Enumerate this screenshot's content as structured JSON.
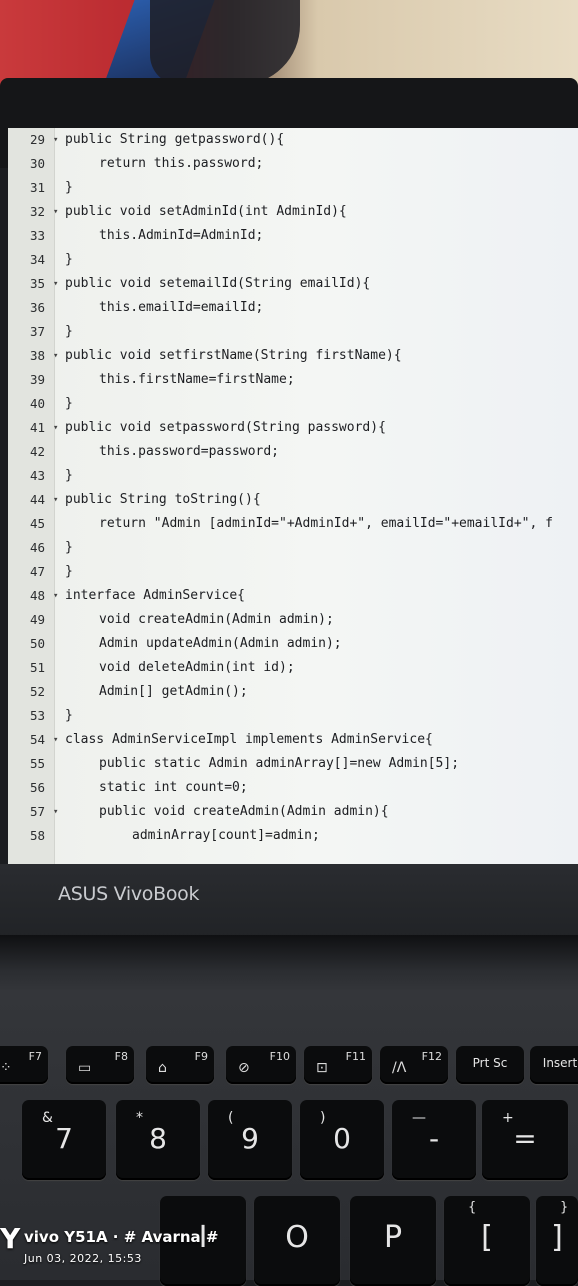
{
  "screen": {
    "lines": [
      {
        "n": "29",
        "fold": true,
        "indent": 0,
        "text": "public String getpassword(){"
      },
      {
        "n": "30",
        "fold": false,
        "indent": 1,
        "text": "return this.password;"
      },
      {
        "n": "31",
        "fold": false,
        "indent": 0,
        "text": "}"
      },
      {
        "n": "32",
        "fold": true,
        "indent": 0,
        "text": "public void setAdminId(int AdminId){"
      },
      {
        "n": "33",
        "fold": false,
        "indent": 1,
        "text": "this.AdminId=AdminId;"
      },
      {
        "n": "34",
        "fold": false,
        "indent": 0,
        "text": "}"
      },
      {
        "n": "35",
        "fold": true,
        "indent": 0,
        "text": "public void setemailId(String emailId){"
      },
      {
        "n": "36",
        "fold": false,
        "indent": 1,
        "text": "this.emailId=emailId;"
      },
      {
        "n": "37",
        "fold": false,
        "indent": 0,
        "text": "}"
      },
      {
        "n": "38",
        "fold": true,
        "indent": 0,
        "text": "public void setfirstName(String firstName){"
      },
      {
        "n": "39",
        "fold": false,
        "indent": 1,
        "text": "this.firstName=firstName;"
      },
      {
        "n": "40",
        "fold": false,
        "indent": 0,
        "text": "}"
      },
      {
        "n": "41",
        "fold": true,
        "indent": 0,
        "text": "public void setpassword(String password){"
      },
      {
        "n": "42",
        "fold": false,
        "indent": 1,
        "text": "this.password=password;"
      },
      {
        "n": "43",
        "fold": false,
        "indent": 0,
        "text": "}"
      },
      {
        "n": "44",
        "fold": true,
        "indent": 0,
        "text": "public String toString(){"
      },
      {
        "n": "45",
        "fold": false,
        "indent": 1,
        "text": "return \"Admin [adminId=\"+AdminId+\", emailId=\"+emailId+\", f"
      },
      {
        "n": "46",
        "fold": false,
        "indent": 0,
        "text": "}"
      },
      {
        "n": "47",
        "fold": false,
        "indent": 0,
        "text": "}"
      },
      {
        "n": "48",
        "fold": true,
        "indent": 0,
        "text": "interface AdminService{"
      },
      {
        "n": "49",
        "fold": false,
        "indent": 1,
        "text": "void createAdmin(Admin admin);"
      },
      {
        "n": "50",
        "fold": false,
        "indent": 1,
        "text": "Admin updateAdmin(Admin admin);"
      },
      {
        "n": "51",
        "fold": false,
        "indent": 1,
        "text": "void deleteAdmin(int id);"
      },
      {
        "n": "52",
        "fold": false,
        "indent": 1,
        "text": "Admin[] getAdmin();"
      },
      {
        "n": "53",
        "fold": false,
        "indent": 0,
        "text": "}"
      },
      {
        "n": "54",
        "fold": true,
        "indent": 0,
        "text": "class AdminServiceImpl implements AdminService{"
      },
      {
        "n": "55",
        "fold": false,
        "indent": 1,
        "text": "public static Admin adminArray[]=new Admin[5];"
      },
      {
        "n": "56",
        "fold": false,
        "indent": 1,
        "text": "static int count=0;"
      },
      {
        "n": "57",
        "fold": true,
        "indent": 1,
        "text": "public void createAdmin(Admin admin){"
      },
      {
        "n": "58",
        "fold": false,
        "indent": 2,
        "text": "adminArray[count]=admin;"
      }
    ]
  },
  "laptop": {
    "brand": "ASUS VivoBook"
  },
  "keyboard": {
    "fkeys": [
      {
        "label": "F7",
        "icon": "brightness-icon",
        "glyph": "⁘"
      },
      {
        "label": "F8",
        "icon": "display-icon",
        "glyph": "▭"
      },
      {
        "label": "F9",
        "icon": "touchpad-lock-icon",
        "glyph": "⌂"
      },
      {
        "label": "F10",
        "icon": "camera-off-icon",
        "glyph": "⊘"
      },
      {
        "label": "F11",
        "icon": "screenshot-icon",
        "glyph": "⊡"
      },
      {
        "label": "F12",
        "icon": "myasus-icon",
        "glyph": "/Λ"
      },
      {
        "label": "Prt Sc",
        "icon": "",
        "glyph": ""
      },
      {
        "label": "Insert",
        "icon": "",
        "glyph": ""
      }
    ],
    "numkeys": [
      {
        "main": "7",
        "alt": "&"
      },
      {
        "main": "8",
        "alt": "*"
      },
      {
        "main": "9",
        "alt": "("
      },
      {
        "main": "0",
        "alt": ")"
      },
      {
        "main": "-",
        "alt": "—"
      },
      {
        "main": "=",
        "alt": "+"
      }
    ],
    "letterkeys": [
      {
        "main": "I",
        "alt": ""
      },
      {
        "main": "O",
        "alt": ""
      },
      {
        "main": "P",
        "alt": ""
      },
      {
        "main": "[",
        "alt": "{"
      },
      {
        "main": "]",
        "alt": "}"
      }
    ]
  },
  "watermark": {
    "brand": "vivo Y51A · # Avarna #",
    "datetime": "Jun 03, 2022, 15:53"
  }
}
